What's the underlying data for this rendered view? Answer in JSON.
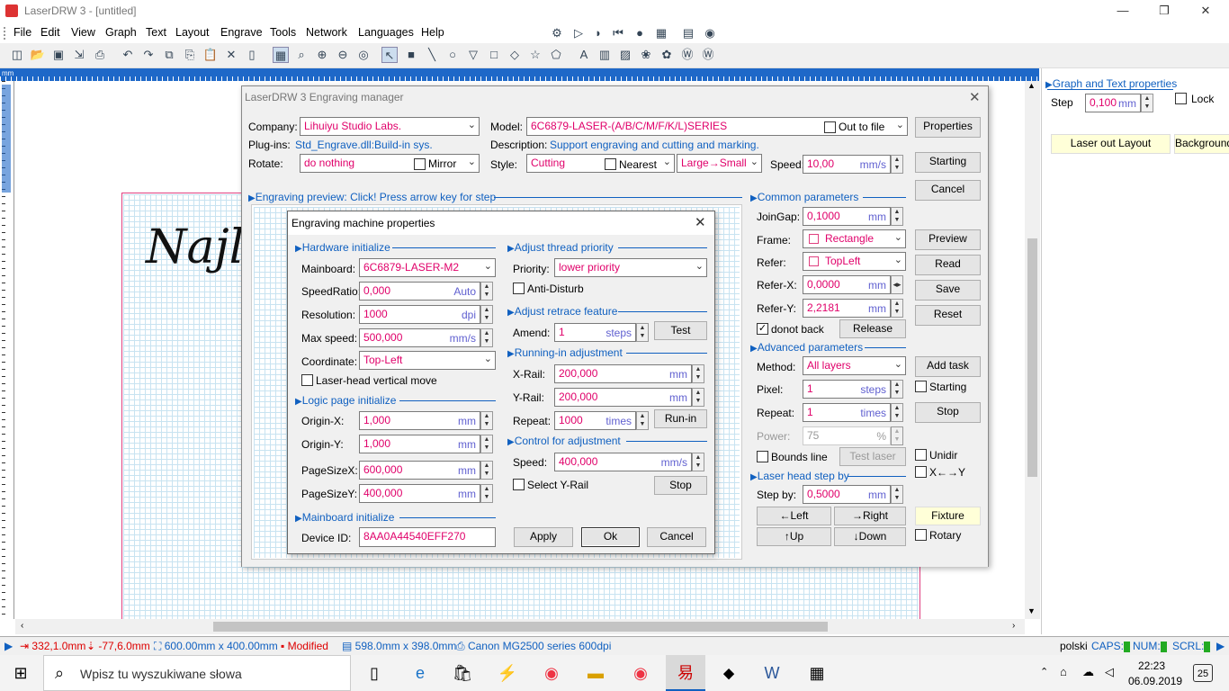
{
  "window": {
    "title": "LaserDRW 3 - [untitled]"
  },
  "menu": [
    "File",
    "Edit",
    "View",
    "Graph",
    "Text",
    "Layout",
    "Engrave",
    "Tools",
    "Network",
    "Languages",
    "Help"
  ],
  "canvas": {
    "sample_text": "Najlep",
    "sample_text2": "N"
  },
  "right_panel": {
    "title": "Graph and Text properties",
    "step_label": "Step",
    "step_value": "0,100",
    "step_unit": "mm",
    "lock_label": "Lock",
    "laser_out_button": "Laser out Layout",
    "background_button": "Background"
  },
  "engrave_mgr": {
    "title": "LaserDRW 3 Engraving manager",
    "company_label": "Company:",
    "company_value": "Lihuiyu Studio Labs.",
    "plugins_label": "Plug-ins:",
    "plugins_value": "Std_Engrave.dll:Build-in sys.",
    "rotate_label": "Rotate:",
    "rotate_value": "do nothing",
    "mirror_label": "Mirror",
    "model_label": "Model:",
    "model_value": "6C6879-LASER-(A/B/C/M/F/K/L)SERIES",
    "out_to_file_label": "Out to file",
    "description_label": "Description:",
    "description_value": "Support engraving and cutting and marking.",
    "style_label": "Style:",
    "style_value": "Cutting",
    "nearest_label": "Nearest",
    "order_value": "Large→Small",
    "speed_label": "Speed:",
    "speed_value": "10,00",
    "speed_unit": "mm/s",
    "properties_button": "Properties",
    "starting_button": "Starting",
    "cancel_button": "Cancel",
    "preview_section": "Engraving preview: Click! Press arrow key for step",
    "common_section": "Common parameters",
    "joingap_label": "JoinGap:",
    "joingap_value": "0,1000",
    "joingap_unit": "mm",
    "frame_label": "Frame:",
    "frame_value": "Rectangle",
    "refer_label": "Refer:",
    "refer_value": "TopLeft",
    "referx_label": "Refer-X:",
    "referx_value": "0,0000",
    "referx_unit": "mm",
    "refery_label": "Refer-Y:",
    "refery_value": "2,2181",
    "refery_unit": "mm",
    "donot_back_label": "donot back",
    "release_button": "Release",
    "preview_button": "Preview",
    "read_button": "Read",
    "save_button": "Save",
    "reset_button": "Reset",
    "advanced_section": "Advanced parameters",
    "method_label": "Method:",
    "method_value": "All layers",
    "pixel_label": "Pixel:",
    "pixel_value": "1",
    "pixel_unit": "steps",
    "repeat_label": "Repeat:",
    "repeat_value": "1",
    "repeat_unit": "times",
    "power_label": "Power:",
    "power_value": "75",
    "power_unit": "%",
    "add_task_button": "Add task",
    "starting_check": "Starting",
    "stop_button": "Stop",
    "bounds_label": "Bounds line",
    "test_laser_button": "Test laser",
    "unidir_label": "Unidir",
    "xy_label": "X←→Y",
    "headstep_section": "Laser head step by",
    "stepby_label": "Step by:",
    "stepby_value": "0,5000",
    "stepby_unit": "mm",
    "left_button": "←Left",
    "right_button": "→Right",
    "up_button": "↑Up",
    "down_button": "↓Down",
    "fixture_button": "Fixture",
    "rotary_label": "Rotary"
  },
  "machine_props": {
    "title": "Engraving machine properties",
    "hw_section": "Hardware initialize",
    "mainboard_label": "Mainboard:",
    "mainboard_value": "6C6879-LASER-M2",
    "speedratio_label": "SpeedRatio:",
    "speedratio_value": "0,000",
    "speedratio_unit": "Auto",
    "resolution_label": "Resolution:",
    "resolution_value": "1000",
    "resolution_unit": "dpi",
    "maxspeed_label": "Max speed:",
    "maxspeed_value": "500,000",
    "maxspeed_unit": "mm/s",
    "coordinate_label": "Coordinate:",
    "coordinate_value": "Top-Left",
    "laserhead_label": "Laser-head vertical move",
    "logic_section": "Logic page initialize",
    "originx_label": "Origin-X:",
    "originx_value": "1,000",
    "originx_unit": "mm",
    "originy_label": "Origin-Y:",
    "originy_value": "1,000",
    "originy_unit": "mm",
    "pagesizex_label": "PageSizeX:",
    "pagesizex_value": "600,000",
    "pagesizex_unit": "mm",
    "pagesizey_label": "PageSizeY:",
    "pagesizey_value": "400,000",
    "pagesizey_unit": "mm",
    "mb_section": "Mainboard initialize",
    "deviceid_label": "Device ID:",
    "deviceid_value": "8AA0A44540EFF270",
    "thread_section": "Adjust thread priority",
    "priority_label": "Priority:",
    "priority_value": "lower priority",
    "antidisturb_label": "Anti-Disturb",
    "retrace_section": "Adjust retrace feature",
    "amend_label": "Amend:",
    "amend_value": "1",
    "amend_unit": "steps",
    "test_button": "Test",
    "runin_section": "Running-in adjustment",
    "xrail_label": "X-Rail:",
    "xrail_value": "200,000",
    "xrail_unit": "mm",
    "yrail_label": "Y-Rail:",
    "yrail_value": "200,000",
    "yrail_unit": "mm",
    "repeat_label": "Repeat:",
    "repeat_value": "1000",
    "repeat_unit": "times",
    "runin_button": "Run-in",
    "control_section": "Control for adjustment",
    "speed_label": "Speed:",
    "speed_value": "400,000",
    "speed_unit": "mm/s",
    "selectyrail_label": "Select Y-Rail",
    "stop_button": "Stop",
    "apply_button": "Apply",
    "ok_button": "Ok",
    "cancel_button": "Cancel"
  },
  "status": {
    "x": "332,1.0mm",
    "y": "-77,6.0mm",
    "size": "600.00mm x 400.00mm",
    "modified": "Modified",
    "page": "598.0mm x 398.0mm",
    "printer": "Canon MG2500 series 600dpi",
    "lang": "polski",
    "caps": "CAPS:",
    "num": "NUM:",
    "scrl": "SCRL:"
  },
  "taskbar": {
    "search_placeholder": "Wpisz tu wyszukiwane słowa",
    "time": "22:23",
    "date": "06.09.2019",
    "notif": "25"
  }
}
